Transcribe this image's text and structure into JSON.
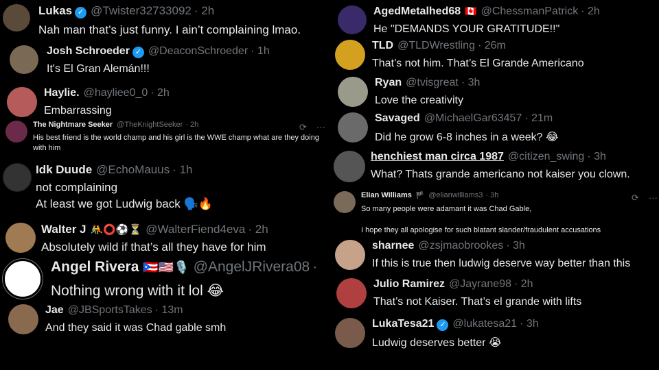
{
  "left": [
    {
      "name": "Lukas",
      "handle": "@Twister32733092",
      "time": "· 2h",
      "text": "Nah man that’s just funny. I ain’t complaining lmao.",
      "verified": true,
      "avatar_color": "#5a4a3a"
    },
    {
      "name": "Josh Schroeder",
      "handle": "@DeaconSchroeder",
      "time": "· 1h",
      "text": "It's El Gran Alemán!!!",
      "verified": true,
      "avatar_color": "#7a6a55"
    },
    {
      "name": "Haylie.",
      "handle": "@hayliee0_0",
      "time": "· 2h",
      "text": "Embarrassing",
      "verified": false,
      "avatar_color": "#b55b5b"
    },
    {
      "name": "The Nightmare Seeker",
      "handle": "@TheKnightSeeker",
      "time": "· 2h",
      "text": "His best friend is the world champ and his girl is the WWE champ what are they doing with him",
      "verified": false,
      "avatar_color": "#6b2a4a"
    },
    {
      "name": "Idk Duude",
      "handle": "@EchoMauus",
      "time": "· 1h",
      "line1": "not complaining",
      "line2": "At least we got Ludwig back 🗣️🔥",
      "verified": false,
      "avatar_color": "#333333"
    },
    {
      "name": "Walter J",
      "emoji": "🤼⭕⚽⏳",
      "handle": "@WalterFiend4eva",
      "time": "· 2h",
      "text": "Absolutely wild if that’s all they have for him",
      "verified": false,
      "avatar_color": "#a07a52"
    },
    {
      "name": "Angel Rivera",
      "emoji": "🇵🇷🇺🇸🎙️",
      "handle": "@AngelJRivera08",
      "time": "·",
      "text": "Nothing wrong with it lol 😂",
      "verified": false,
      "avatar_color": "#ffffff"
    },
    {
      "name": "Jae",
      "handle": "@JBSportsTakes",
      "time": "· 13m",
      "text": "And they said it was Chad gable smh",
      "verified": false,
      "avatar_color": "#8a6a4e"
    }
  ],
  "right": [
    {
      "name": "AgedMetalhed68",
      "emoji": "🇨🇦",
      "handle": "@ChessmanPatrick",
      "time": "· 2h",
      "text": "He \"DEMANDS YOUR GRATITUDE!!\"",
      "verified": false,
      "avatar_color": "#3a2a6a"
    },
    {
      "name": "TLD",
      "handle": "@TLDWrestling",
      "time": "· 26m",
      "text": "That’s not him. That’s El Grande Americano",
      "verified": false,
      "avatar_color": "#d4a020"
    },
    {
      "name": "Ryan",
      "handle": "@tvisgreat",
      "time": "· 3h",
      "text": "Love the creativity",
      "verified": false,
      "avatar_color": "#9a9a8a"
    },
    {
      "name": "Savaged",
      "handle": "@MichaelGar63457",
      "time": "· 21m",
      "text": "Did he grow 6-8 inches in a week? 😂",
      "verified": false,
      "avatar_color": "#6a6a6a"
    },
    {
      "name": "henchiest man circa 1987",
      "handle": "@citizen_swing",
      "time": "· 3h",
      "text": "What? Thats grande americano not kaiser you clown.",
      "verified": false,
      "avatar_color": "#555555"
    },
    {
      "name": "Elian Williams",
      "emoji": "🏴",
      "handle": "@elianwilliams3",
      "time": "· 3h",
      "line1": "So many people were adamant it was Chad Gable,",
      "line2": "I hope they all apologise for such blatant slander/fraudulent accusations",
      "verified": false,
      "avatar_color": "#7a6a5a"
    },
    {
      "name": "sharnee",
      "handle": "@zsjmaobrookes",
      "time": "· 3h",
      "text": "If this is true then ludwig deserve way better than this",
      "verified": false,
      "avatar_color": "#c7a28a"
    },
    {
      "name": "Julio Ramirez",
      "handle": "@Jayrane98",
      "time": "· 2h",
      "text": "That’s not Kaiser. That’s el grande with lifts",
      "verified": false,
      "avatar_color": "#b04040"
    },
    {
      "name": "LukaTesa21",
      "handle": "@lukatesa21",
      "time": "· 3h",
      "text": "Ludwig deserves better 😭",
      "verified": true,
      "avatar_color": "#7a5a4a"
    }
  ],
  "icons": {
    "grok": "⟳",
    "more": "···",
    "verified_mark": "✓"
  }
}
